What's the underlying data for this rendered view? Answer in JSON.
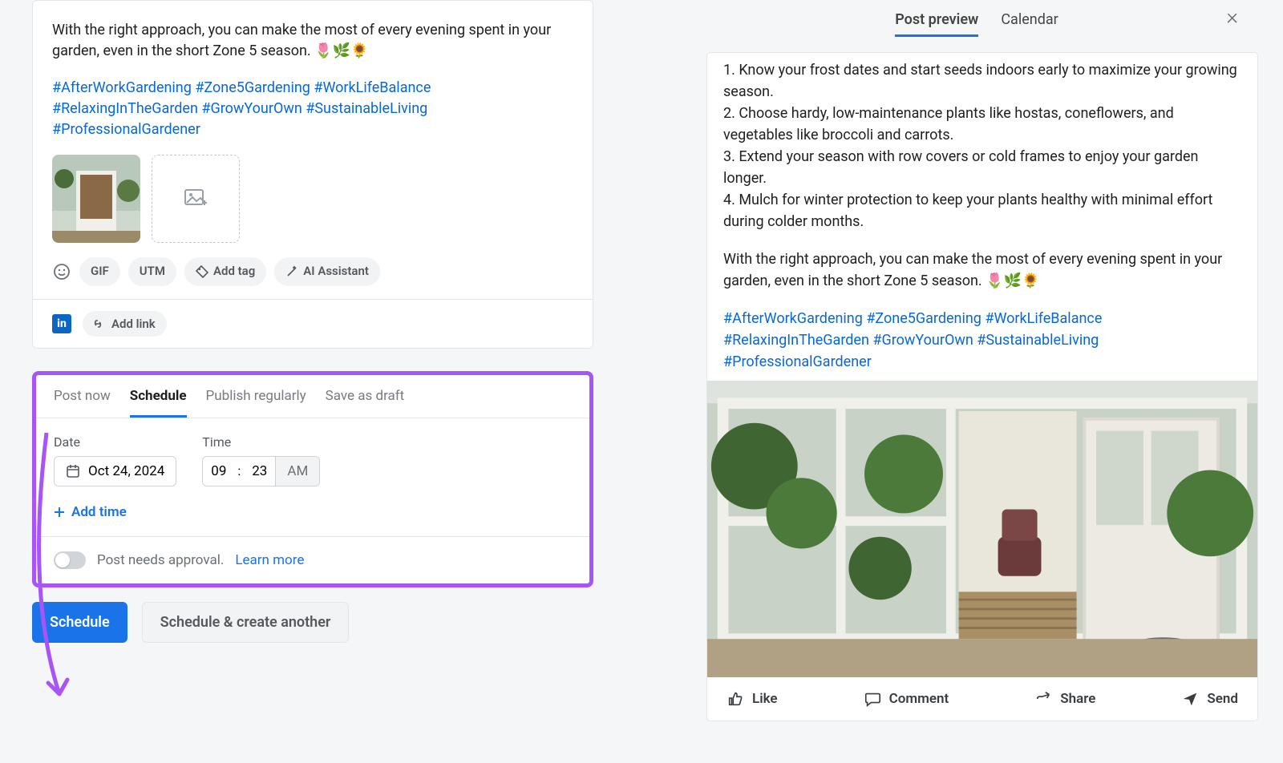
{
  "compose": {
    "body": "With the right approach, you can make the most of every evening spent in your garden, even in the short Zone 5 season. 🌷🌿🌻",
    "hashtags_line1": "#AfterWorkGardening #Zone5Gardening #WorkLifeBalance #RelaxingInTheGarden #GrowYourOwn #SustainableLiving #ProfessionalGardener",
    "chips": {
      "gif": "GIF",
      "utm": "UTM",
      "add_tag": "Add tag",
      "ai": "AI Assistant"
    },
    "linkedin_label": "in",
    "add_link": "Add link"
  },
  "schedule": {
    "tabs": [
      "Post now",
      "Schedule",
      "Publish regularly",
      "Save as draft"
    ],
    "active_tab": "Schedule",
    "date_label": "Date",
    "time_label": "Time",
    "date_value": "Oct 24, 2024",
    "hour": "09",
    "minute": "23",
    "ampm": "AM",
    "add_time": "Add time",
    "approval_text": "Post needs approval.",
    "learn_more": "Learn more"
  },
  "buttons": {
    "primary": "Schedule",
    "secondary": "Schedule & create another"
  },
  "preview": {
    "tabs": [
      "Post preview",
      "Calendar"
    ],
    "active_tab": "Post preview",
    "tips": [
      "1. Know your frost dates and start seeds indoors early to maximize your growing season.",
      "2. Choose hardy, low-maintenance plants like hostas, coneflowers, and vegetables like broccoli and carrots.",
      "3. Extend your season with row covers or cold frames to enjoy your garden longer.",
      "4. Mulch for winter protection to keep your plants healthy with minimal effort during colder months."
    ],
    "para": "With the right approach, you can make the most of every evening spent in your garden, even in the short Zone 5 season. 🌷🌿🌻",
    "hashtags": "#AfterWorkGardening #Zone5Gardening #WorkLifeBalance #RelaxingInTheGarden #GrowYourOwn #SustainableLiving #ProfessionalGardener",
    "actions": {
      "like": "Like",
      "comment": "Comment",
      "share": "Share",
      "send": "Send"
    }
  }
}
